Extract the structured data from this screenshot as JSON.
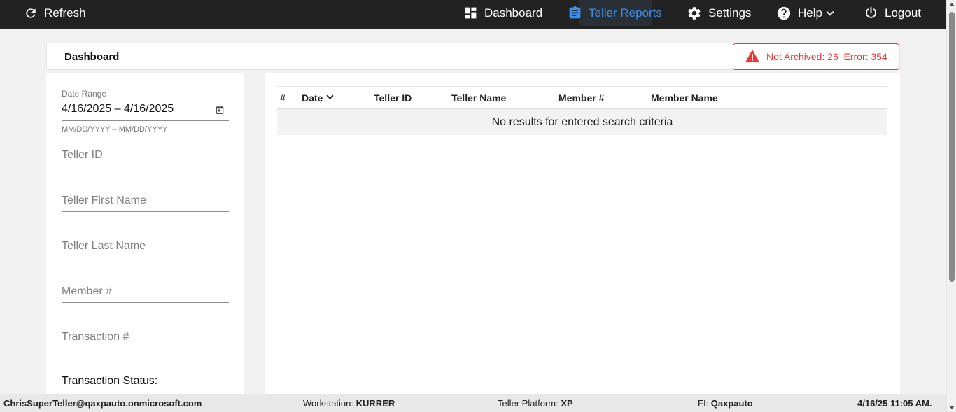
{
  "nav": {
    "refresh": "Refresh",
    "dashboard": "Dashboard",
    "teller_reports": "Teller Reports",
    "settings": "Settings",
    "help": "Help",
    "logout": "Logout",
    "active_color": "#3b8fe8"
  },
  "header": {
    "title": "Dashboard",
    "alert_text": "Not Archived: 26  Error: 354",
    "alert_color": "#e53935"
  },
  "filters": {
    "date_range_label": "Date Range",
    "date_range_value": "4/16/2025 – 4/16/2025",
    "date_hint": "MM/DD/YYYY – MM/DD/YYYY",
    "teller_id": "Teller ID",
    "teller_first_name": "Teller First Name",
    "teller_last_name": "Teller Last Name",
    "member_number": "Member #",
    "transaction_number": "Transaction #",
    "transaction_status_label": "Transaction Status:"
  },
  "table": {
    "columns": [
      "#",
      "Date",
      "Teller ID",
      "Teller Name",
      "Member #",
      "Member Name"
    ],
    "empty_message": "No results for entered search criteria"
  },
  "footer": {
    "user": "ChrisSuperTeller@qaxpauto.onmicrosoft.com",
    "workstation_label": "Workstation:",
    "workstation_value": "KURRER",
    "platform_label": "Teller Platform:",
    "platform_value": "XP",
    "fi_label": "FI:",
    "fi_value": "Qaxpauto",
    "datetime": "4/16/25 11:05 AM."
  }
}
